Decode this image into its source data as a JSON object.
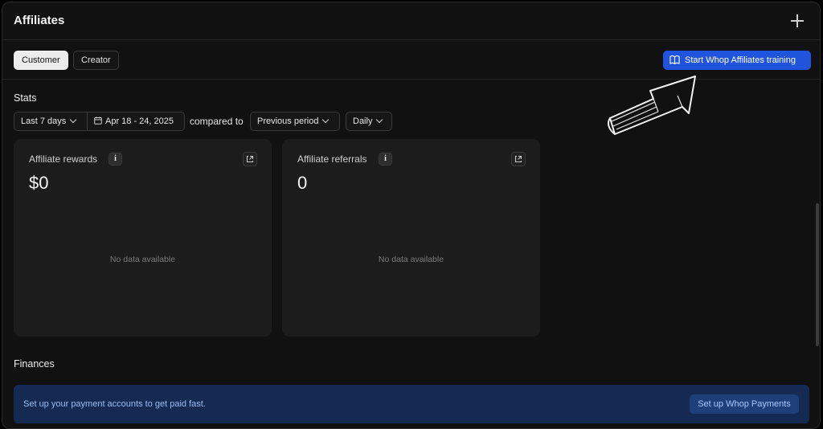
{
  "header": {
    "title": "Affiliates",
    "add_icon": "plus-icon"
  },
  "tabs": [
    {
      "label": "Customer",
      "active": true
    },
    {
      "label": "Creator",
      "active": false
    }
  ],
  "training_button": {
    "label": "Start Whop Affiliates training",
    "icon": "book-icon",
    "color": "#2054dd"
  },
  "stats": {
    "title": "Stats",
    "range": "Last 7 days",
    "dates": "Apr 18 - 24, 2025",
    "compared_label": "compared to",
    "comparison": "Previous period",
    "granularity": "Daily"
  },
  "cards": [
    {
      "label": "Affiliate rewards",
      "value": "$0",
      "empty": "No data available"
    },
    {
      "label": "Affiliate referrals",
      "value": "0",
      "empty": "No data available"
    }
  ],
  "finances": {
    "title": "Finances",
    "banner_text": "Set up your payment accounts to get paid fast.",
    "banner_button": "Set up Whop Payments"
  },
  "annotation_icon": "hand-drawn-arrow-icon"
}
